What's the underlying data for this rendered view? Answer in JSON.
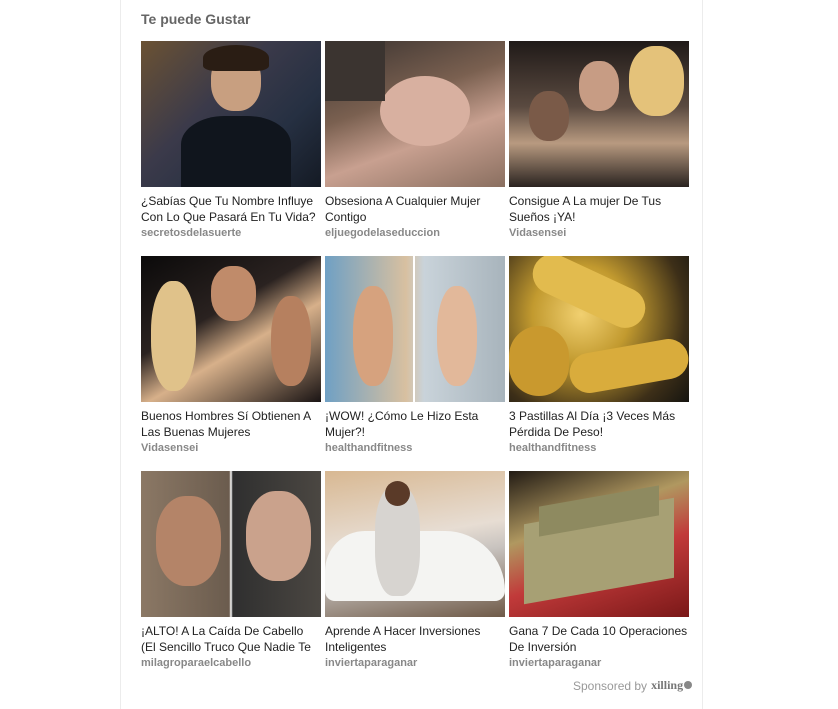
{
  "widget": {
    "heading": "Te puede Gustar",
    "sponsor_prefix": "Sponsored by",
    "sponsor_brand": "xilling"
  },
  "cards": [
    {
      "title": "¿Sabías Que Tu Nombre Influye Con Lo Que Pasará En Tu Vida?",
      "source": "secretosdelasuerte"
    },
    {
      "title": "Obsesiona A Cualquier Mujer Contigo",
      "source": "eljuegodelaseduccion"
    },
    {
      "title": "Consigue A La mujer De Tus Sueños ¡YA!",
      "source": "Vidasensei"
    },
    {
      "title": "Buenos Hombres Sí Obtienen A Las Buenas Mujeres",
      "source": "Vidasensei"
    },
    {
      "title": "¡WOW! ¿Cómo Le Hizo Esta Mujer?!",
      "source": "healthandfitness"
    },
    {
      "title": "3 Pastillas Al Día ¡3 Veces Más Pérdida De Peso!",
      "source": "healthandfitness"
    },
    {
      "title": "¡ALTO! A La Caída De Cabello (El Sencillo Truco Que Nadie Te Dijo)",
      "source": "milagroparaelcabello"
    },
    {
      "title": "Aprende A Hacer Inversiones Inteligentes",
      "source": "inviertaparaganar"
    },
    {
      "title": "Gana 7 De Cada 10 Operaciones De Inversión",
      "source": "inviertaparaganar"
    }
  ]
}
